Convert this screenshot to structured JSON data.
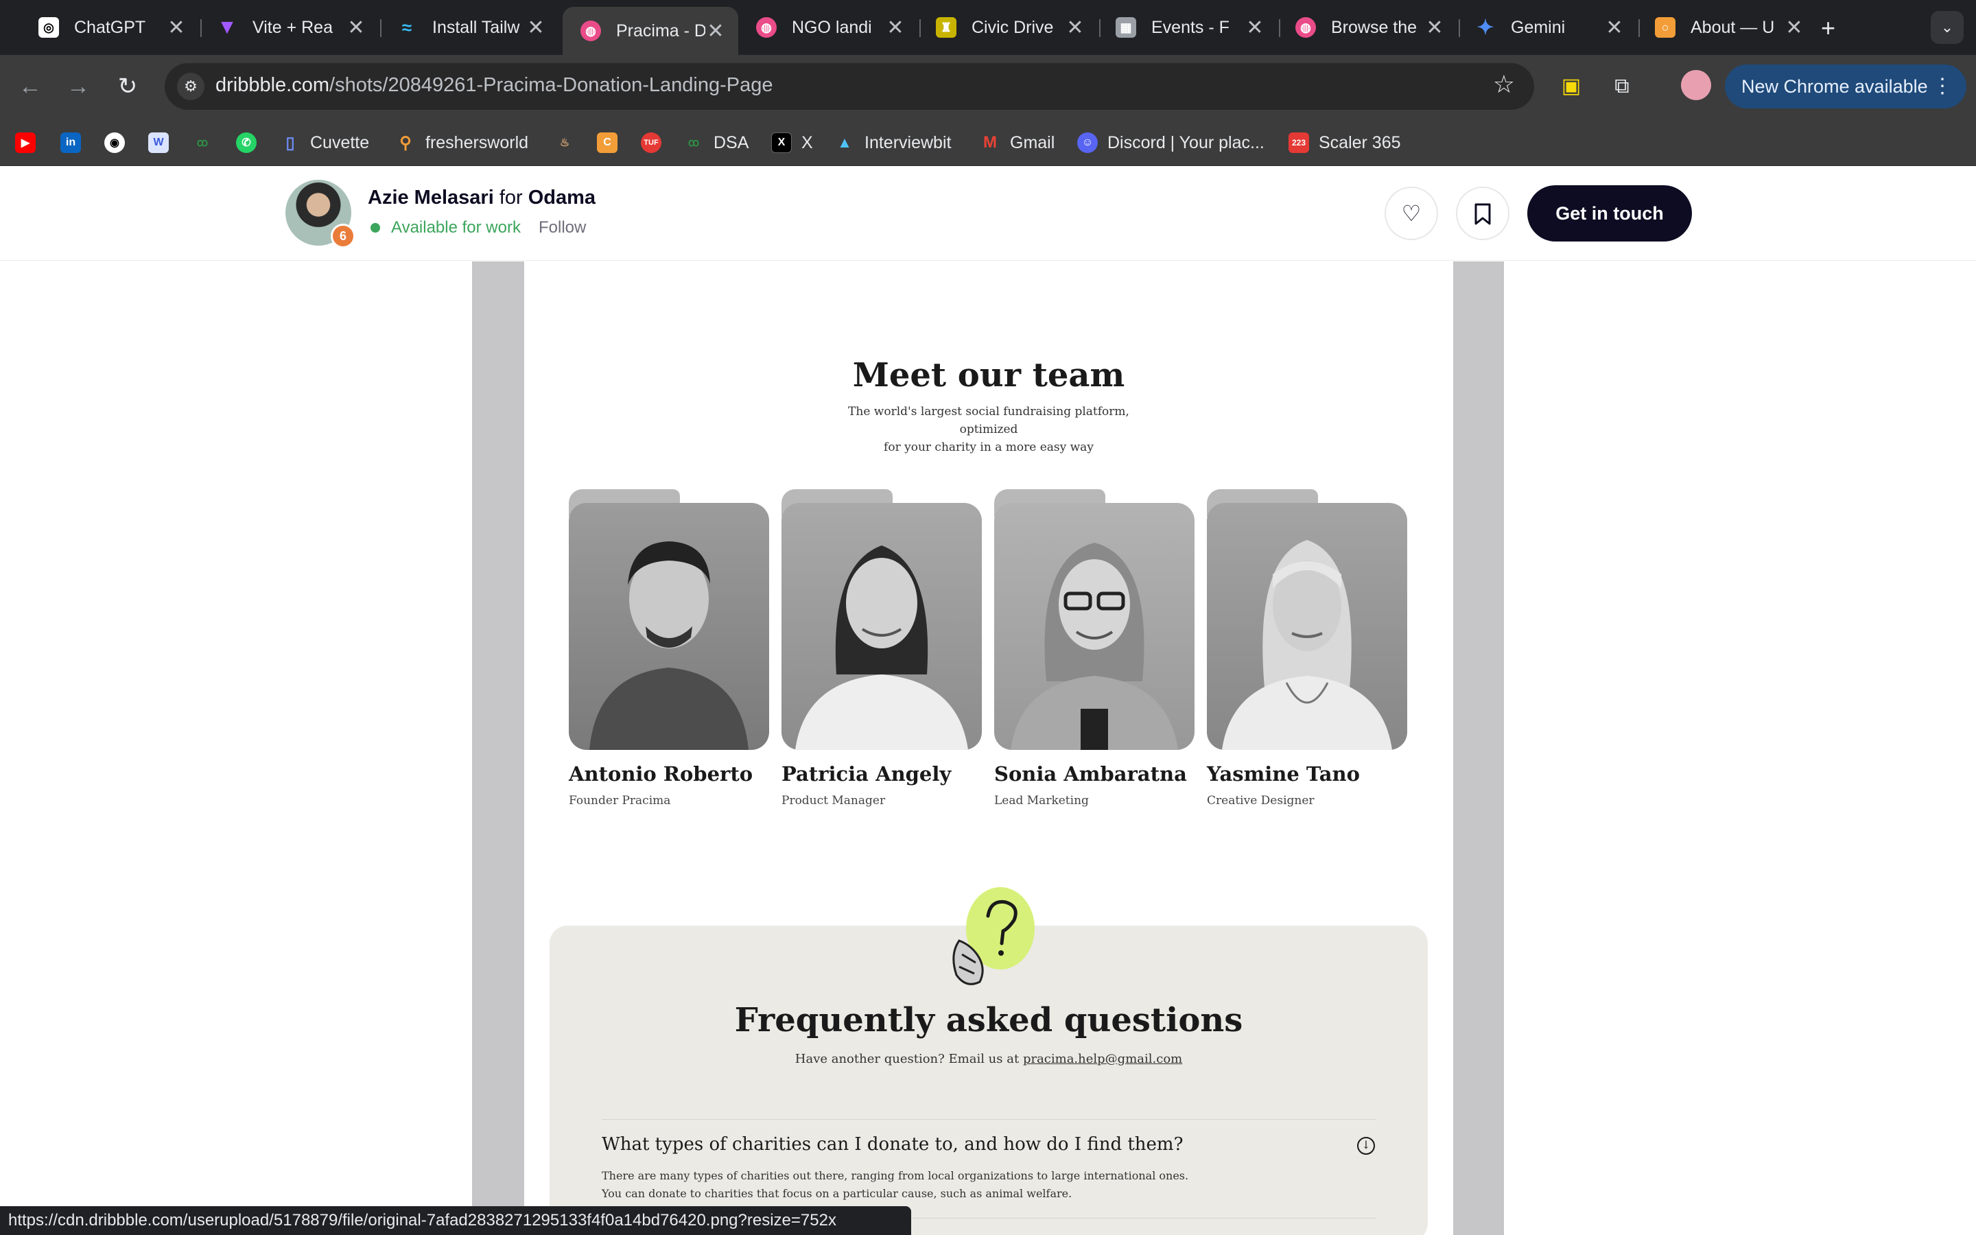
{
  "browser": {
    "tabs": [
      {
        "title": "ChatGPT",
        "icon": "chatgpt-icon",
        "color": "#ffffff"
      },
      {
        "title": "Vite + Rea",
        "icon": "vite-icon",
        "color": "#a259ff"
      },
      {
        "title": "Install Tailw",
        "icon": "tailwind-icon",
        "color": "#38bdf8"
      },
      {
        "title": "Pracima - D",
        "icon": "dribbble-icon",
        "color": "#ea4c89"
      },
      {
        "title": "NGO landi",
        "icon": "dribbble-icon",
        "color": "#ea4c89"
      },
      {
        "title": "Civic Drive",
        "icon": "civic-icon",
        "color": "#c8b400"
      },
      {
        "title": "Events - F",
        "icon": "events-icon",
        "color": "#9aa0a6"
      },
      {
        "title": "Browse the",
        "icon": "dribbble-icon",
        "color": "#ea4c89"
      },
      {
        "title": "Gemini",
        "icon": "gemini-icon",
        "color": "#4f8df5"
      },
      {
        "title": "About — U",
        "icon": "about-icon",
        "color": "#f29d38"
      }
    ],
    "active_tab_index": 3,
    "new_tab_label": "+",
    "url_host": "dribbble.com",
    "url_path": "/shots/20849261-Pracima-Donation-Landing-Page",
    "chrome_update": "New Chrome available",
    "bookmarks": [
      {
        "label": "",
        "icon": "youtube-icon",
        "color": "#ff0000"
      },
      {
        "label": "",
        "icon": "linkedin-icon",
        "color": "#0a66c2"
      },
      {
        "label": "",
        "icon": "github-icon",
        "color": "#ffffff"
      },
      {
        "label": "",
        "icon": "w-icon",
        "color": "#3b5bdb"
      },
      {
        "label": "",
        "icon": "gfg-icon",
        "color": "#2f8d46"
      },
      {
        "label": "",
        "icon": "whatsapp-icon",
        "color": "#25d366"
      },
      {
        "label": "Cuvette",
        "icon": "cuvette-icon",
        "color": "#3b5bdb"
      },
      {
        "label": "freshersworld",
        "icon": "freshersworld-icon",
        "color": "#f29d38"
      },
      {
        "label": "",
        "icon": "codechef-icon",
        "color": "#8b5a2b"
      },
      {
        "label": "",
        "icon": "c-icon",
        "color": "#f29d38"
      },
      {
        "label": "",
        "icon": "tuf-icon",
        "color": "#e53935"
      },
      {
        "label": "DSA",
        "icon": "gfg-icon",
        "color": "#2f8d46"
      },
      {
        "label": "X",
        "icon": "x-icon",
        "color": "#000000"
      },
      {
        "label": "Interviewbit",
        "icon": "interviewbit-icon",
        "color": "#4fc3f7"
      },
      {
        "label": "Gmail",
        "icon": "gmail-icon",
        "color": "#ea4335"
      },
      {
        "label": "Discord | Your plac...",
        "icon": "discord-icon",
        "color": "#5865f2"
      },
      {
        "label": "Scaler 365",
        "icon": "scaler-icon",
        "color": "#e53935"
      }
    ],
    "status_url": "https://cdn.dribbble.com/userupload/5178879/file/original-7afad2838271295133f4f0a14bd76420.png?resize=752x"
  },
  "shot_header": {
    "designer": "Azie Melasari",
    "for_word": "for",
    "team": "Odama",
    "availability": "Available for work",
    "follow": "Follow",
    "cta": "Get in touch",
    "badge": "6"
  },
  "shot": {
    "team_title": "Meet our team",
    "team_sub_1": "The world's largest social fundraising platform, optimized",
    "team_sub_2": "for your charity in a more easy way",
    "members": [
      {
        "name": "Antonio Roberto",
        "role": "Founder Pracima"
      },
      {
        "name": "Patricia Angely",
        "role": "Product Manager"
      },
      {
        "name": "Sonia Ambaratna",
        "role": "Lead Marketing"
      },
      {
        "name": "Yasmine Tano",
        "role": "Creative Designer"
      }
    ],
    "faq_title": "Frequently asked questions",
    "faq_sub": "Have another question? Email us at",
    "faq_email": "pracima.help@gmail.com",
    "faq_items": [
      {
        "question": "What types of charities can I donate to, and how do I find them?",
        "answer_1": "There are many types of charities out there, ranging from local organizations to large international ones.",
        "answer_2": "You can donate to charities that focus on a particular cause, such as animal welfare."
      }
    ]
  },
  "colors": {
    "accent": "#0d0c22",
    "available": "#3ca55c",
    "faq_bg": "#ebeae4",
    "question_blob": "#d7f07a"
  }
}
